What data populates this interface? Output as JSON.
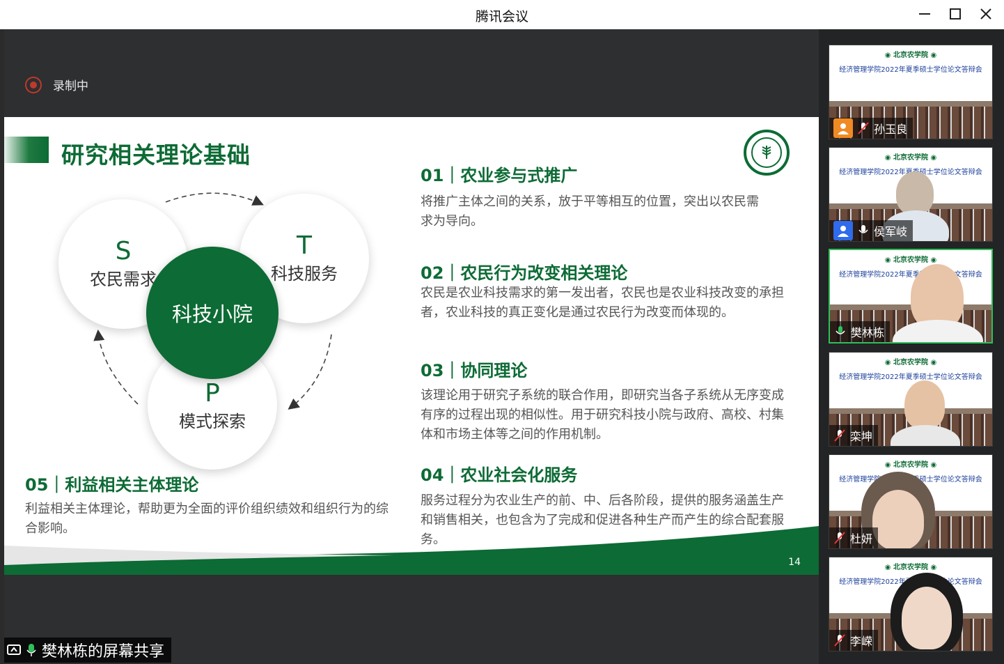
{
  "window": {
    "title": "腾讯会议",
    "minimize_icon": "minimize-icon",
    "maximize_icon": "maximize-icon",
    "close_icon": "close-icon"
  },
  "recording": {
    "label": "录制中"
  },
  "slide": {
    "title": "研究相关理论基础",
    "page_number": "14",
    "diagram": {
      "s_letter": "S",
      "s_label": "农民需求",
      "t_letter": "T",
      "t_label": "科技服务",
      "p_letter": "P",
      "p_label": "模式探索",
      "center_label": "科技小院"
    },
    "sections": [
      {
        "head": "01｜农业参与式推广",
        "body": "将推广主体之间的关系，放于平等相互的位置，突出以农民需求为导向。"
      },
      {
        "head": "02｜农民行为改变相关理论",
        "body": "农民是农业科技需求的第一发出者，农民也是农业科技改变的承担者，农业科技的真正变化是通过农民行为改变而体现的。"
      },
      {
        "head": "03｜协同理论",
        "body": "该理论用于研究子系统的联合作用，即研究当各子系统从无序变成有序的过程出现的相似性。用于研究科技小院与政府、高校、村集体和市场主体等之间的作用机制。"
      },
      {
        "head": "04｜农业社会化服务",
        "body": "服务过程分为农业生产的前、中、后各阶段，提供的服务涵盖生产和销售相关，也包含为了完成和促进各种生产而产生的综合配套服务。"
      },
      {
        "head": "05｜利益相关主体理论",
        "body": "利益相关主体理论，帮助更为全面的评价组织绩效和组织行为的综合影响。"
      }
    ]
  },
  "share": {
    "label": "樊林栋的屏幕共享"
  },
  "participants": [
    {
      "name": "孙玉良",
      "mic": "muted",
      "avatar_color": "#f08a24"
    },
    {
      "name": "侯军岐",
      "mic": "on",
      "avatar_color": "#2f6bea"
    },
    {
      "name": "樊林栋",
      "mic": "speaking",
      "avatar_color": ""
    },
    {
      "name": "栾坤",
      "mic": "muted",
      "avatar_color": ""
    },
    {
      "name": "杜妍",
      "mic": "muted",
      "avatar_color": ""
    },
    {
      "name": "李嵘",
      "mic": "muted",
      "avatar_color": ""
    }
  ],
  "colors": {
    "brand_green": "#0d6b35",
    "active_border": "#2fbf5a"
  }
}
